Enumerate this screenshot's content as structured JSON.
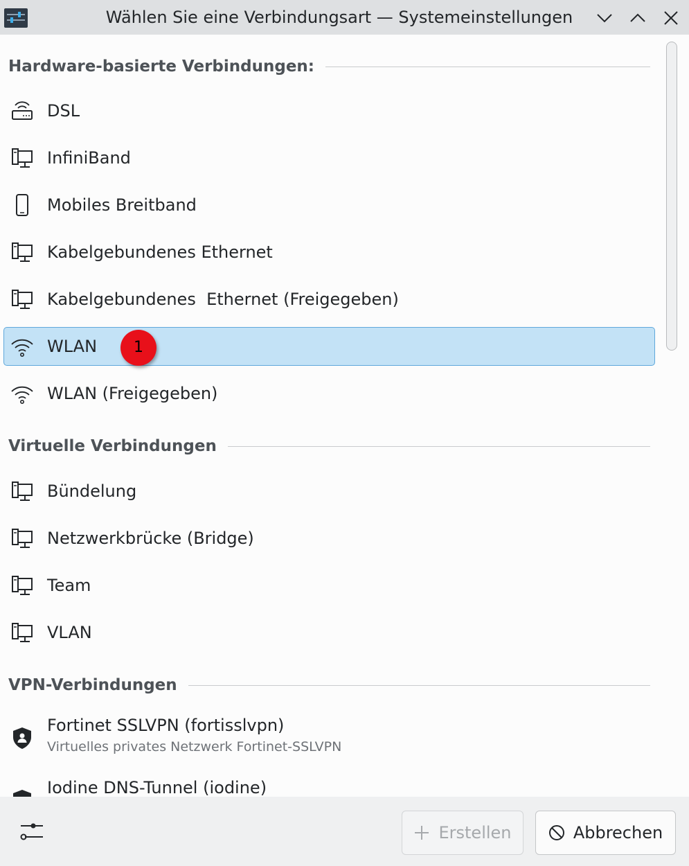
{
  "window": {
    "title": "Wählen Sie eine Verbindungsart — Systemeinstellungen"
  },
  "sections": {
    "hardware": "Hardware-basierte Verbindungen:",
    "virtual": "Virtuelle Verbindungen",
    "vpn": "VPN-Verbindungen"
  },
  "items": {
    "dsl": "DSL",
    "infiniband": "InfiniBand",
    "mobile": "Mobiles Breitband",
    "ethernet": "Kabelgebundenes Ethernet",
    "ethernet_shared": "Kabelgebundenes  Ethernet (Freigegeben)",
    "wlan": "WLAN",
    "wlan_shared": "WLAN (Freigegeben)",
    "bond": "Bündelung",
    "bridge": "Netzwerkbrücke (Bridge)",
    "team": "Team",
    "vlan": "VLAN",
    "fortinet": "Fortinet SSLVPN (fortisslvpn)",
    "fortinet_sub": "Virtuelles privates Netzwerk Fortinet-SSLVPN",
    "iodine": "Iodine DNS-Tunnel (iodine)"
  },
  "annotation": {
    "badge": "1"
  },
  "buttons": {
    "create": "Erstellen",
    "cancel": "Abbrechen"
  },
  "colors": {
    "selection_bg": "#c3e2f6",
    "selection_border": "#5fa8db",
    "badge": "#e8101a"
  },
  "icons": {
    "dsl": "router-icon",
    "wired": "wired-network-icon",
    "mobile": "phone-icon",
    "wifi": "wifi-icon",
    "vpn": "shield-icon",
    "footer": "sliders-icon"
  }
}
